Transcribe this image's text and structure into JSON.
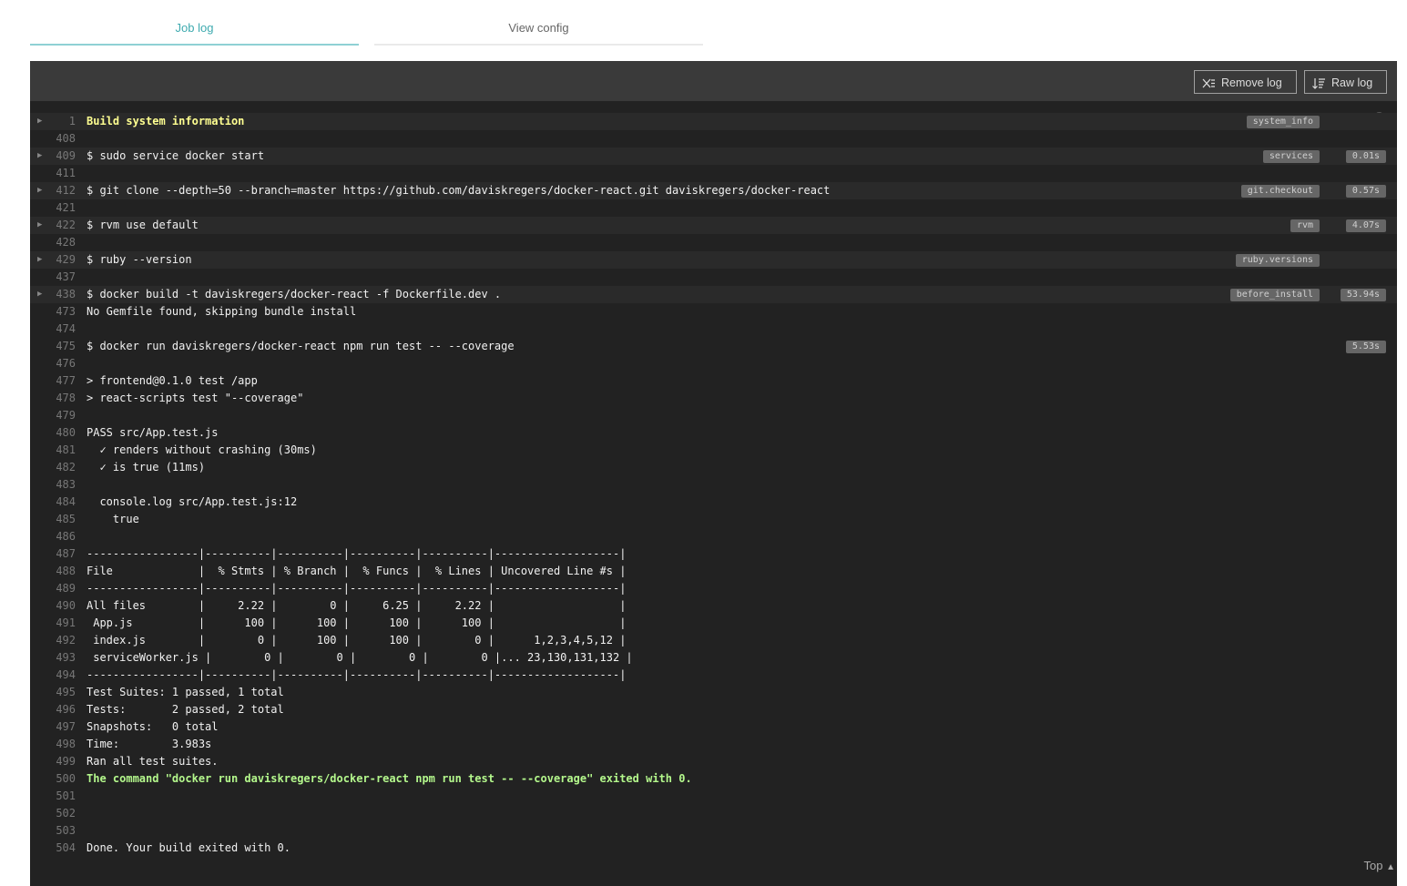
{
  "tabs": [
    {
      "label": "Job log",
      "active": true
    },
    {
      "label": "View config",
      "active": false
    }
  ],
  "toolbar": {
    "remove_log": "Remove log",
    "raw_log": "Raw log"
  },
  "footer": {
    "top": "Top"
  },
  "colors": {
    "accent": "#3eaaaf",
    "log_bg": "#222222",
    "yellow": "#ffff91",
    "green": "#b4f88c"
  },
  "lines": [
    {
      "n": "1",
      "t": "Build system information",
      "fold": true,
      "tag": "system_info",
      "style": "yellow"
    },
    {
      "n": "408",
      "t": ""
    },
    {
      "n": "409",
      "t": "$ sudo service docker start",
      "fold": true,
      "tag": "services",
      "dur": "0.01s"
    },
    {
      "n": "411",
      "t": ""
    },
    {
      "n": "412",
      "t": "$ git clone --depth=50 --branch=master https://github.com/daviskregers/docker-react.git daviskregers/docker-react",
      "fold": true,
      "tag": "git.checkout",
      "dur": "0.57s"
    },
    {
      "n": "421",
      "t": ""
    },
    {
      "n": "422",
      "t": "$ rvm use default",
      "fold": true,
      "tag": "rvm",
      "dur": "4.07s"
    },
    {
      "n": "428",
      "t": ""
    },
    {
      "n": "429",
      "t": "$ ruby --version",
      "fold": true,
      "tag": "ruby.versions"
    },
    {
      "n": "437",
      "t": ""
    },
    {
      "n": "438",
      "t": "$ docker build -t daviskregers/docker-react -f Dockerfile.dev .",
      "fold": true,
      "tag": "before_install",
      "dur": "53.94s"
    },
    {
      "n": "473",
      "t": "No Gemfile found, skipping bundle install"
    },
    {
      "n": "474",
      "t": ""
    },
    {
      "n": "475",
      "t": "$ docker run daviskregers/docker-react npm run test -- --coverage",
      "dur": "5.53s"
    },
    {
      "n": "476",
      "t": ""
    },
    {
      "n": "477",
      "t": "> frontend@0.1.0 test /app"
    },
    {
      "n": "478",
      "t": "> react-scripts test \"--coverage\""
    },
    {
      "n": "479",
      "t": ""
    },
    {
      "n": "480",
      "t": "PASS src/App.test.js"
    },
    {
      "n": "481",
      "t": "  ✓ renders without crashing (30ms)"
    },
    {
      "n": "482",
      "t": "  ✓ is true (11ms)"
    },
    {
      "n": "483",
      "t": ""
    },
    {
      "n": "484",
      "t": "  console.log src/App.test.js:12"
    },
    {
      "n": "485",
      "t": "    true"
    },
    {
      "n": "486",
      "t": ""
    },
    {
      "n": "487",
      "t": "-----------------|----------|----------|----------|----------|-------------------|"
    },
    {
      "n": "488",
      "t": "File             |  % Stmts | % Branch |  % Funcs |  % Lines | Uncovered Line #s |"
    },
    {
      "n": "489",
      "t": "-----------------|----------|----------|----------|----------|-------------------|"
    },
    {
      "n": "490",
      "t": "All files        |     2.22 |        0 |     6.25 |     2.22 |                   |"
    },
    {
      "n": "491",
      "t": " App.js          |      100 |      100 |      100 |      100 |                   |"
    },
    {
      "n": "492",
      "t": " index.js        |        0 |      100 |      100 |        0 |      1,2,3,4,5,12 |"
    },
    {
      "n": "493",
      "t": " serviceWorker.js |        0 |        0 |        0 |        0 |... 23,130,131,132 |"
    },
    {
      "n": "494",
      "t": "-----------------|----------|----------|----------|----------|-------------------|"
    },
    {
      "n": "495",
      "t": "Test Suites: 1 passed, 1 total"
    },
    {
      "n": "496",
      "t": "Tests:       2 passed, 2 total"
    },
    {
      "n": "497",
      "t": "Snapshots:   0 total"
    },
    {
      "n": "498",
      "t": "Time:        3.983s"
    },
    {
      "n": "499",
      "t": "Ran all test suites."
    },
    {
      "n": "500",
      "t": "The command \"docker run daviskregers/docker-react npm run test -- --coverage\" exited with 0.",
      "style": "green"
    },
    {
      "n": "501",
      "t": ""
    },
    {
      "n": "502",
      "t": ""
    },
    {
      "n": "503",
      "t": ""
    },
    {
      "n": "504",
      "t": "Done. Your build exited with 0."
    }
  ]
}
